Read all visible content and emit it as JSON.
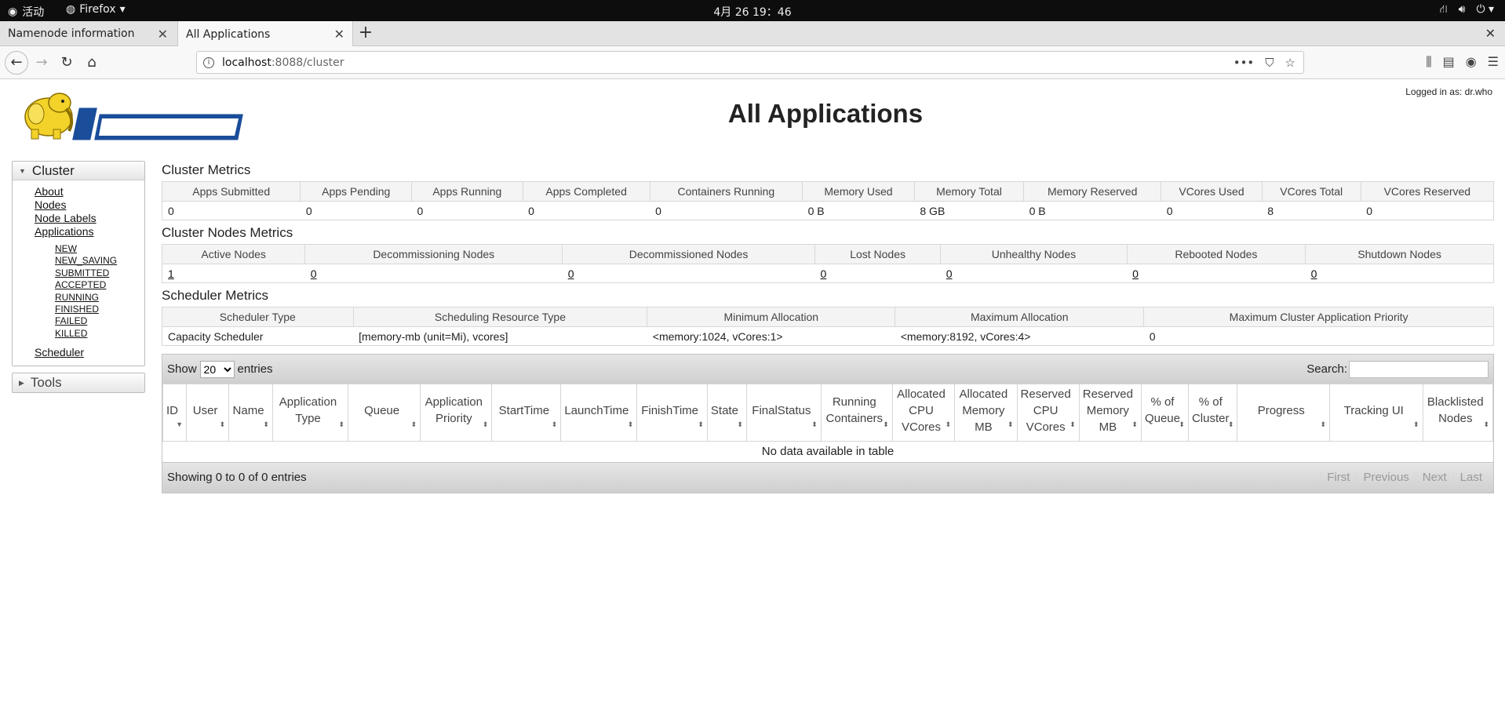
{
  "system": {
    "activities": "活动",
    "app_menu": "Firefox",
    "clock": "4月 26 19：46"
  },
  "tabs": [
    {
      "title": "Namenode information"
    },
    {
      "title": "All Applications"
    }
  ],
  "url": {
    "host": "localhost",
    "rest": ":8088/cluster"
  },
  "page": {
    "title": "All Applications",
    "logged_in": "Logged in as: dr.who"
  },
  "sidebar": {
    "cluster_title": "Cluster",
    "links": [
      "About",
      "Nodes",
      "Node Labels",
      "Applications"
    ],
    "states": [
      "NEW",
      "NEW_SAVING",
      "SUBMITTED",
      "ACCEPTED",
      "RUNNING",
      "FINISHED",
      "FAILED",
      "KILLED"
    ],
    "scheduler": "Scheduler",
    "tools_title": "Tools"
  },
  "cluster_metrics": {
    "title": "Cluster Metrics",
    "headers": [
      "Apps Submitted",
      "Apps Pending",
      "Apps Running",
      "Apps Completed",
      "Containers Running",
      "Memory Used",
      "Memory Total",
      "Memory Reserved",
      "VCores Used",
      "VCores Total",
      "VCores Reserved"
    ],
    "values": [
      "0",
      "0",
      "0",
      "0",
      "0",
      "0 B",
      "8 GB",
      "0 B",
      "0",
      "8",
      "0"
    ]
  },
  "node_metrics": {
    "title": "Cluster Nodes Metrics",
    "headers": [
      "Active Nodes",
      "Decommissioning Nodes",
      "Decommissioned Nodes",
      "Lost Nodes",
      "Unhealthy Nodes",
      "Rebooted Nodes",
      "Shutdown Nodes"
    ],
    "values": [
      "1",
      "0",
      "0",
      "0",
      "0",
      "0",
      "0"
    ]
  },
  "scheduler_metrics": {
    "title": "Scheduler Metrics",
    "headers": [
      "Scheduler Type",
      "Scheduling Resource Type",
      "Minimum Allocation",
      "Maximum Allocation",
      "Maximum Cluster Application Priority"
    ],
    "values": [
      "Capacity Scheduler",
      "[memory-mb (unit=Mi), vcores]",
      "<memory:1024, vCores:1>",
      "<memory:8192, vCores:4>",
      "0"
    ]
  },
  "apps_table": {
    "show_label": "Show",
    "page_size": "20",
    "entries_label": "entries",
    "search_label": "Search:",
    "columns": [
      "ID",
      "User",
      "Name",
      "Application Type",
      "Queue",
      "Application Priority",
      "StartTime",
      "LaunchTime",
      "FinishTime",
      "State",
      "FinalStatus",
      "Running Containers",
      "Allocated CPU VCores",
      "Allocated Memory MB",
      "Reserved CPU VCores",
      "Reserved Memory MB",
      "% of Queue",
      "% of Cluster",
      "Progress",
      "Tracking UI",
      "Blacklisted Nodes"
    ],
    "empty": "No data available in table",
    "info": "Showing 0 to 0 of 0 entries",
    "pager": [
      "First",
      "Previous",
      "Next",
      "Last"
    ]
  }
}
